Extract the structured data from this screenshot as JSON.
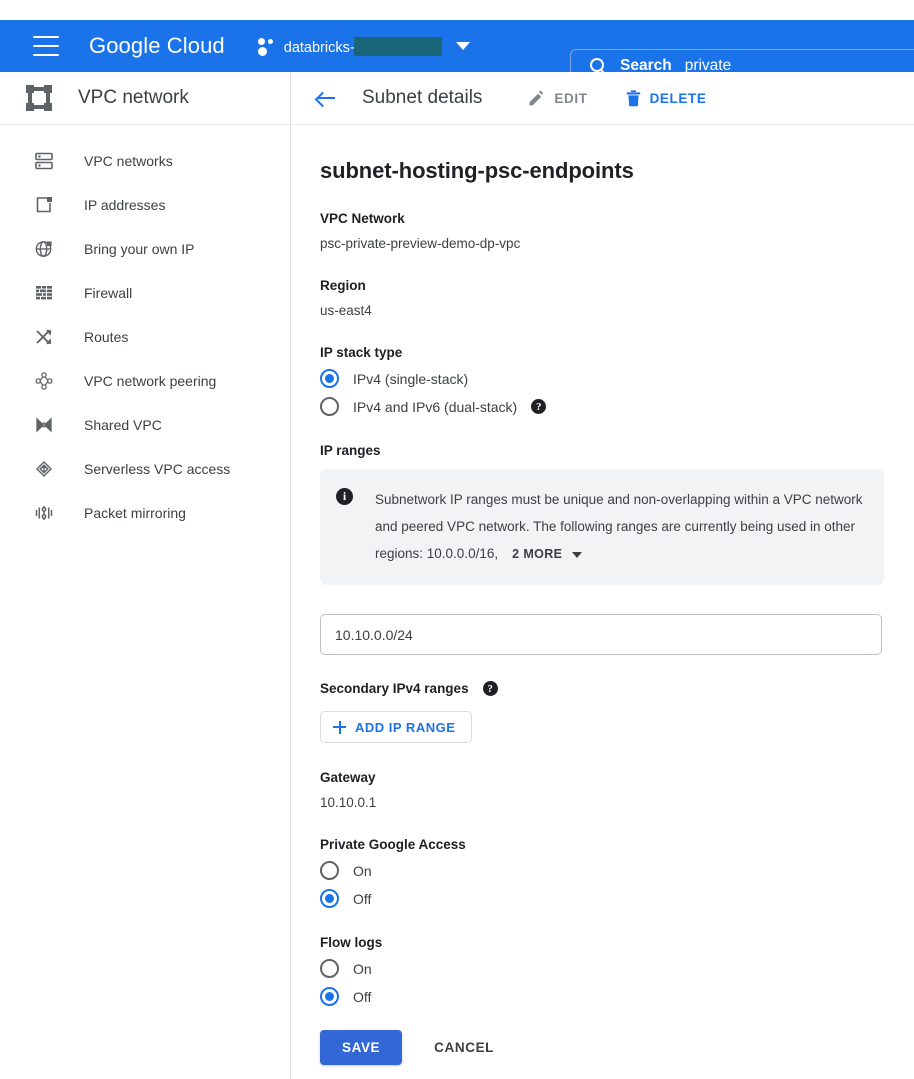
{
  "topbar": {
    "menu_icon": "hamburger-menu-icon",
    "brand_bold": "Google",
    "brand_light": "Cloud",
    "project_name": "databricks-",
    "project_icon": "project-selector-icon",
    "caret_icon": "chevron-down-icon",
    "accent_color": "#1a73e8",
    "redaction_color": "#1a6578"
  },
  "search": {
    "icon": "search-icon",
    "label": "Search",
    "value": "private",
    "placeholder": "Search"
  },
  "sidebar": {
    "header_title": "VPC network",
    "header_icon": "vpc-network-icon",
    "items": [
      {
        "label": "VPC networks",
        "icon": "vpc-networks-icon"
      },
      {
        "label": "IP addresses",
        "icon": "ip-addresses-icon"
      },
      {
        "label": "Bring your own IP",
        "icon": "bring-your-own-ip-icon"
      },
      {
        "label": "Firewall",
        "icon": "firewall-icon"
      },
      {
        "label": "Routes",
        "icon": "routes-icon"
      },
      {
        "label": "VPC network peering",
        "icon": "vpc-network-peering-icon"
      },
      {
        "label": "Shared VPC",
        "icon": "shared-vpc-icon"
      },
      {
        "label": "Serverless VPC access",
        "icon": "serverless-vpc-access-icon"
      },
      {
        "label": "Packet mirroring",
        "icon": "packet-mirroring-icon"
      }
    ]
  },
  "content_header": {
    "back_icon": "back-arrow-icon",
    "title": "Subnet details",
    "edit_label": "EDIT",
    "edit_icon": "pencil-icon",
    "delete_label": "DELETE",
    "delete_icon": "trash-icon"
  },
  "main": {
    "page_title": "subnet-hosting-psc-endpoints",
    "vpc_network_label": "VPC Network",
    "vpc_network_value": "psc-private-preview-demo-dp-vpc",
    "region_label": "Region",
    "region_value": "us-east4",
    "ip_stack_type_label": "IP stack type",
    "ip_stack_options": [
      {
        "label": "IPv4 (single-stack)",
        "selected": true,
        "help": false
      },
      {
        "label": "IPv4 and IPv6 (dual-stack)",
        "selected": false,
        "help": true
      }
    ],
    "ip_ranges_label": "IP ranges",
    "info_icon": "info-icon",
    "info_text": "Subnetwork IP ranges must be unique and non-overlapping within a VPC network and peered VPC network. The following ranges are currently being used in other regions: 10.0.0.0/16,",
    "info_more_label": "2 MORE",
    "info_more_caret": "chevron-down-icon",
    "ip_range_value": "10.10.0.0/24",
    "ip_range_placeholder": "IP range",
    "secondary_ranges_label": "Secondary IPv4 ranges",
    "secondary_help_icon": "help-icon",
    "add_ip_range_label": "ADD IP RANGE",
    "add_ip_range_icon": "plus-icon",
    "gateway_label": "Gateway",
    "gateway_value": "10.10.0.1",
    "private_google_access_label": "Private Google Access",
    "private_google_access_options": [
      {
        "label": "On",
        "selected": false
      },
      {
        "label": "Off",
        "selected": true
      }
    ],
    "flow_logs_label": "Flow logs",
    "flow_logs_options": [
      {
        "label": "On",
        "selected": false
      },
      {
        "label": "Off",
        "selected": true
      }
    ],
    "save_label": "SAVE",
    "cancel_label": "CANCEL",
    "help_glyph": "?",
    "info_glyph": "i"
  }
}
